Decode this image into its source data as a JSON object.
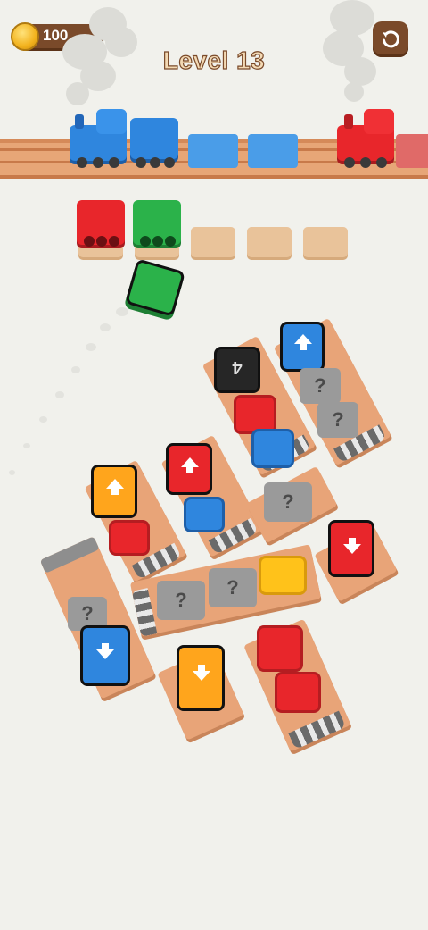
{
  "hud": {
    "coins": "100",
    "level_title": "Level 13",
    "coin_icon": "coin-icon",
    "restart_icon": "restart-icon"
  },
  "colors": {
    "background": "#f1f1ec",
    "track": "#e7a677",
    "red": "#e8262b",
    "blue": "#2f86de",
    "green": "#2bb24a",
    "orange": "#ffa51c",
    "yellow": "#ffc21a",
    "gray": "#8e8e8e"
  },
  "mystery_symbol": "?",
  "hidden_count": "4"
}
